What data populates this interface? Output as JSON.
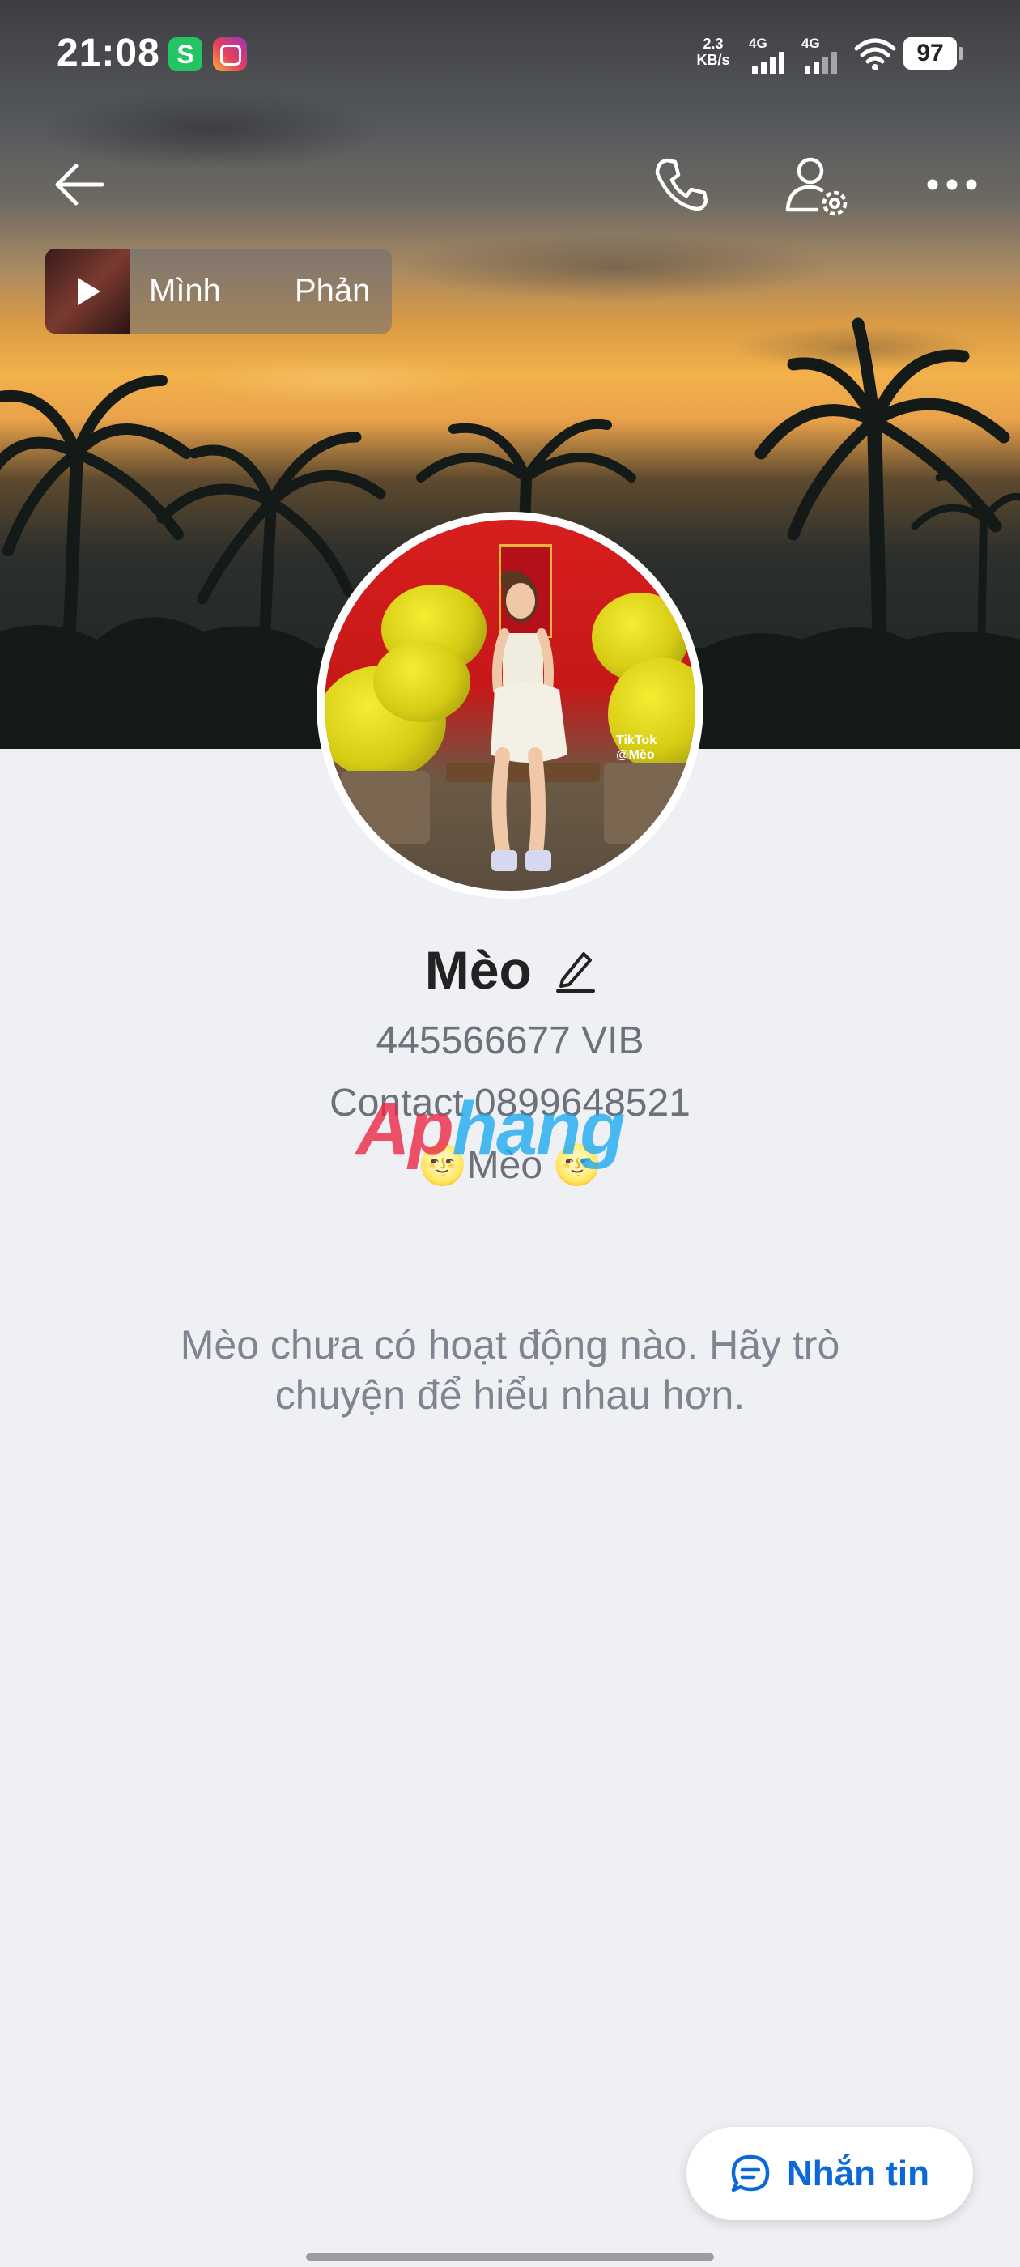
{
  "status_bar": {
    "time": "21:08",
    "app_icons": [
      "s-app-icon",
      "instagram-icon"
    ],
    "net_speed_value": "2.3",
    "net_speed_unit": "KB/s",
    "signal1_label": "4G",
    "signal2_label": "4G",
    "battery": "97"
  },
  "toolbar": {
    "back_icon": "arrow-left-icon",
    "call_icon": "phone-icon",
    "settings_icon": "user-settings-icon",
    "more_icon": "more-horizontal-icon"
  },
  "music": {
    "title_part1": "Mình",
    "title_part2": "Phản"
  },
  "profile": {
    "name": "Mèo",
    "bio_line1": "445566677 VIB",
    "bio_line2": "Contact 0899648521",
    "bio_line3": "🌝Mèo 🌝",
    "avatar_watermark": "TikTok @Mèo"
  },
  "watermark_text_part1": "Ap",
  "watermark_text_part2": "hang",
  "empty_state": "Mèo chưa có hoạt động nào. Hãy trò chuyện để hiểu nhau hơn.",
  "message_button": {
    "label": "Nhắn tin",
    "icon": "chat-bubble-icon",
    "color": "#0b68d8"
  }
}
